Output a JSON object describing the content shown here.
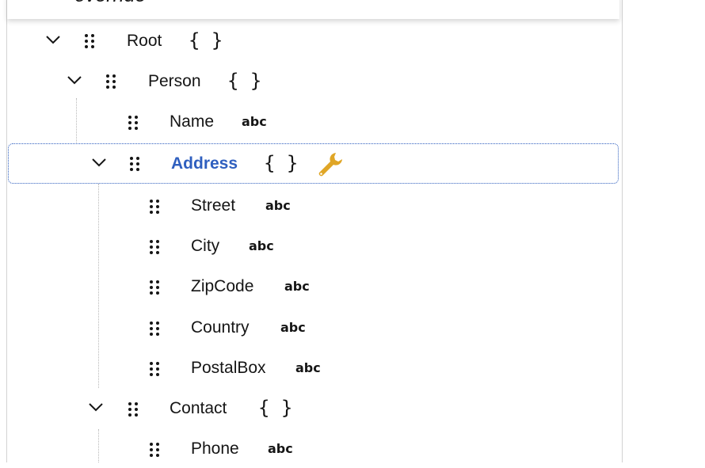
{
  "header": {
    "title": "override"
  },
  "tree": {
    "root": {
      "label": "Root",
      "type_glyph": "{ }"
    },
    "person": {
      "label": "Person",
      "type_glyph": "{ }"
    },
    "name": {
      "label": "Name",
      "type_glyph": "abc"
    },
    "address": {
      "label": "Address",
      "type_glyph": "{ }"
    },
    "street": {
      "label": "Street",
      "type_glyph": "abc"
    },
    "city": {
      "label": "City",
      "type_glyph": "abc"
    },
    "zipcode": {
      "label": "ZipCode",
      "type_glyph": "abc"
    },
    "country": {
      "label": "Country",
      "type_glyph": "abc"
    },
    "postalbox": {
      "label": "PostalBox",
      "type_glyph": "abc"
    },
    "contact": {
      "label": "Contact",
      "type_glyph": "{ }"
    },
    "phone": {
      "label": "Phone",
      "type_glyph": "abc"
    }
  },
  "colors": {
    "selected": "#2f5fbf",
    "wrench": "#e0a626",
    "guide": "#b8b8b8"
  },
  "icons": [
    "chevron-down-icon",
    "drag-handle-icon",
    "object-type-icon",
    "string-type-icon",
    "wrench-icon"
  ]
}
